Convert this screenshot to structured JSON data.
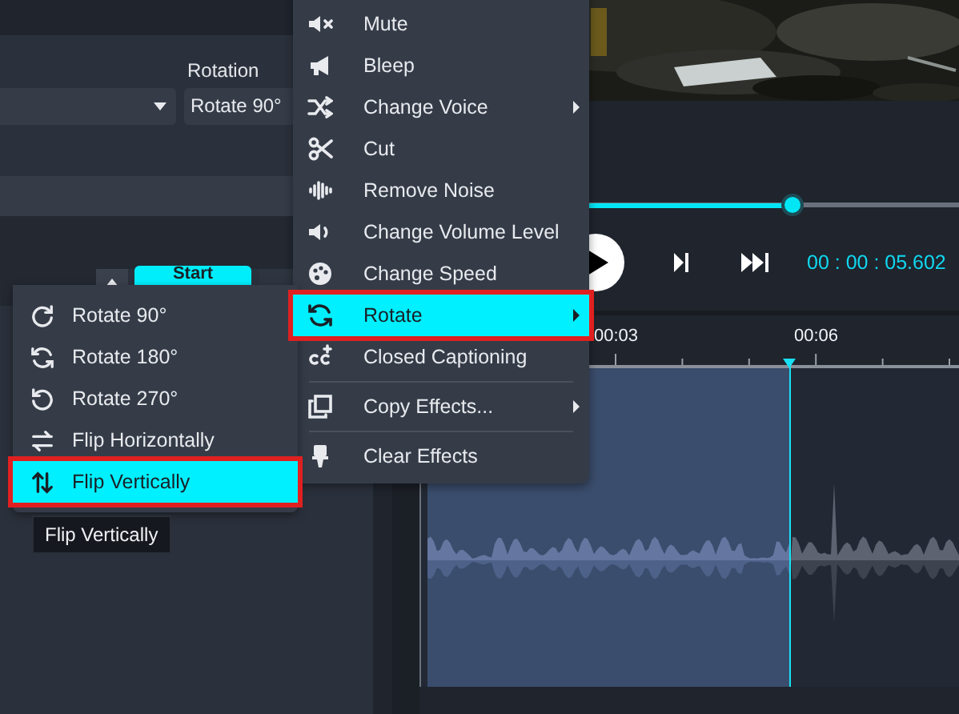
{
  "settings_panel": {
    "rotation_label": "Rotation",
    "rotation_value": "Rotate 90°",
    "start_button": "Start"
  },
  "context_menu": {
    "items": [
      {
        "kind": "item",
        "label": "Mute",
        "selected": false,
        "submenu": false,
        "outlined": false
      },
      {
        "kind": "item",
        "label": "Bleep",
        "selected": false,
        "submenu": false,
        "outlined": false
      },
      {
        "kind": "item",
        "label": "Change Voice",
        "selected": false,
        "submenu": true,
        "outlined": false
      },
      {
        "kind": "item",
        "label": "Cut",
        "selected": false,
        "submenu": false,
        "outlined": false
      },
      {
        "kind": "item",
        "label": "Remove Noise",
        "selected": false,
        "submenu": false,
        "outlined": false
      },
      {
        "kind": "item",
        "label": "Change Volume Level",
        "selected": false,
        "submenu": false,
        "outlined": false
      },
      {
        "kind": "item",
        "label": "Change Speed",
        "selected": false,
        "submenu": false,
        "outlined": false
      },
      {
        "kind": "item",
        "label": "Rotate",
        "selected": true,
        "submenu": true,
        "outlined": true
      },
      {
        "kind": "item",
        "label": "Closed Captioning",
        "selected": false,
        "submenu": false,
        "outlined": false
      },
      {
        "kind": "separator"
      },
      {
        "kind": "item",
        "label": "Copy Effects...",
        "selected": false,
        "submenu": true,
        "outlined": false
      },
      {
        "kind": "separator"
      },
      {
        "kind": "item",
        "label": "Clear Effects",
        "selected": false,
        "submenu": false,
        "outlined": false
      }
    ]
  },
  "rotate_submenu": {
    "items": [
      {
        "label": "Rotate 90°",
        "selected": false,
        "outlined": false
      },
      {
        "label": "Rotate 180°",
        "selected": false,
        "outlined": false
      },
      {
        "label": "Rotate 270°",
        "selected": false,
        "outlined": false
      },
      {
        "label": "Flip Horizontally",
        "selected": false,
        "outlined": false
      },
      {
        "label": "Flip Vertically",
        "selected": true,
        "outlined": true
      }
    ]
  },
  "tooltip": "Flip Vertically",
  "player": {
    "level": 0.55,
    "time": "00 : 00 : 05.602"
  },
  "timeline": {
    "ruler_labels": [
      "00:03",
      "00:06"
    ],
    "clip": {
      "selected": true
    }
  }
}
